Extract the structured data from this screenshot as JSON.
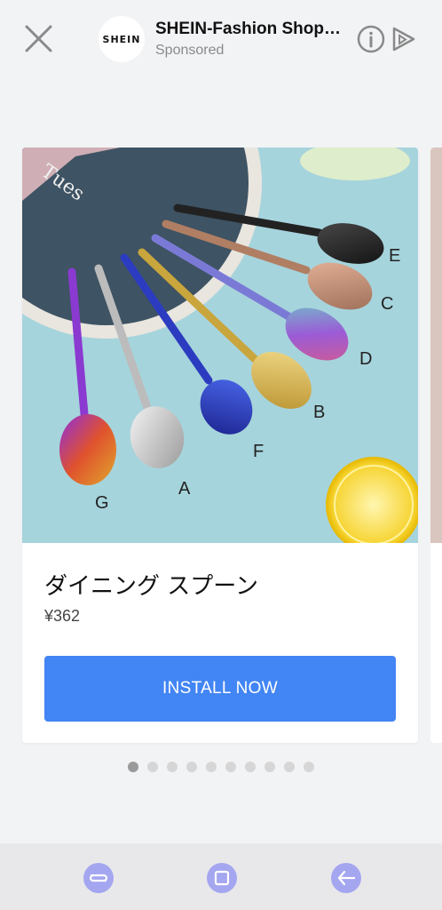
{
  "header": {
    "logo_text": "SHEIN",
    "advertiser_name": "SHEIN-Fashion Shopp...",
    "sponsored_label": "Sponsored"
  },
  "card": {
    "title": "ダイニング スプーン",
    "price": "¥362",
    "cta_label": "INSTALL NOW",
    "image_labels": [
      "E",
      "C",
      "D",
      "B",
      "F",
      "A",
      "G"
    ],
    "image_plate_text": "Tues"
  },
  "carousel": {
    "total_pages": 10,
    "current_page": 1
  },
  "colors": {
    "accent": "#4285f4",
    "background": "#f2f3f5",
    "nav_icon": "#a4a6f0"
  },
  "icons": {
    "close": "close-icon",
    "info": "info-icon",
    "ad_choices": "ad-choices-icon",
    "recent_apps": "recent-apps-icon",
    "home": "home-icon",
    "back": "back-icon"
  }
}
